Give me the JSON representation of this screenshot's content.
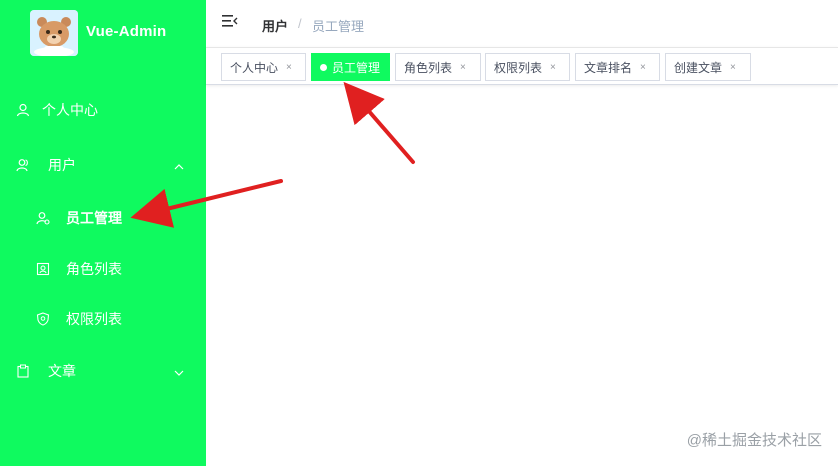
{
  "app": {
    "title": "Vue-Admin"
  },
  "colors": {
    "accent": "#0ffa5f",
    "arrow": "#e02020"
  },
  "sidebar": {
    "items": [
      {
        "label": "个人中心",
        "icon": "user-icon"
      },
      {
        "label": "用户",
        "icon": "users-icon",
        "expanded": true
      },
      {
        "label": "员工管理",
        "icon": "employee-icon",
        "active": true
      },
      {
        "label": "角色列表",
        "icon": "role-icon"
      },
      {
        "label": "权限列表",
        "icon": "shield-icon"
      },
      {
        "label": "文章",
        "icon": "clipboard-icon",
        "expanded": false
      }
    ]
  },
  "breadcrumb": {
    "parent": "用户",
    "separator": "/",
    "current": "员工管理"
  },
  "tags": [
    {
      "label": "个人中心",
      "close": "×"
    },
    {
      "label": "员工管理",
      "active": true
    },
    {
      "label": "角色列表",
      "close": "×"
    },
    {
      "label": "权限列表",
      "close": "×"
    },
    {
      "label": "文章排名",
      "close": "×"
    },
    {
      "label": "创建文章",
      "close": "×"
    }
  ],
  "watermark": "@稀土掘金技术社区"
}
